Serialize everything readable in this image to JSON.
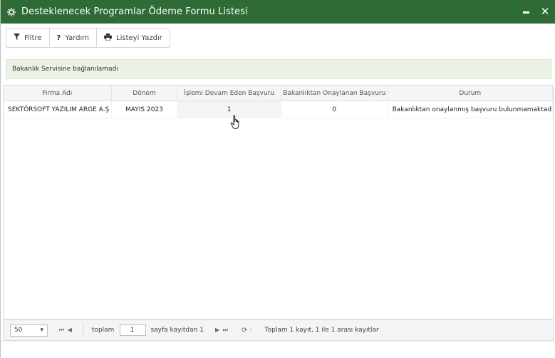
{
  "window": {
    "title": "Desteklenecek Programlar Ödeme Formu Listesi",
    "app_icon": "settings-icon",
    "minimize_icon": "minimize-icon",
    "close_icon": "close-icon"
  },
  "toolbar": {
    "filter_label": "Filtre",
    "help_label": "Yardım",
    "print_label": "Listeyi Yazdır"
  },
  "alert": {
    "message": "Bakanlık Servisine bağlanılamadı"
  },
  "table": {
    "columns": [
      "Firma Adı",
      "Dönem",
      "İşlemi Devam Eden Başvuru",
      "Bakanlıktan Onaylanan Başvuru",
      "Durum"
    ],
    "rows": [
      [
        "SEKTÖRSOFT YAZILIM ARGE A.Ş",
        "MAYIS 2023",
        "1",
        "0",
        "Bakanlıktan onaylanmış başvuru bulunmamaktadır"
      ]
    ]
  },
  "pager": {
    "page_size": "50",
    "first_prev": "⏮ ◀",
    "total_label": "toplam",
    "page_value": "1",
    "page_of_label": "sayfa kayıtdan 1",
    "next_last": "▶ ⏭",
    "refresh": "⟳ ·",
    "summary": "Toplam 1 kayıt, 1 ile 1 arası kayıtlar"
  },
  "colors": {
    "titlebar": "#2f6b35",
    "alert_bg": "#eaf3e6"
  }
}
